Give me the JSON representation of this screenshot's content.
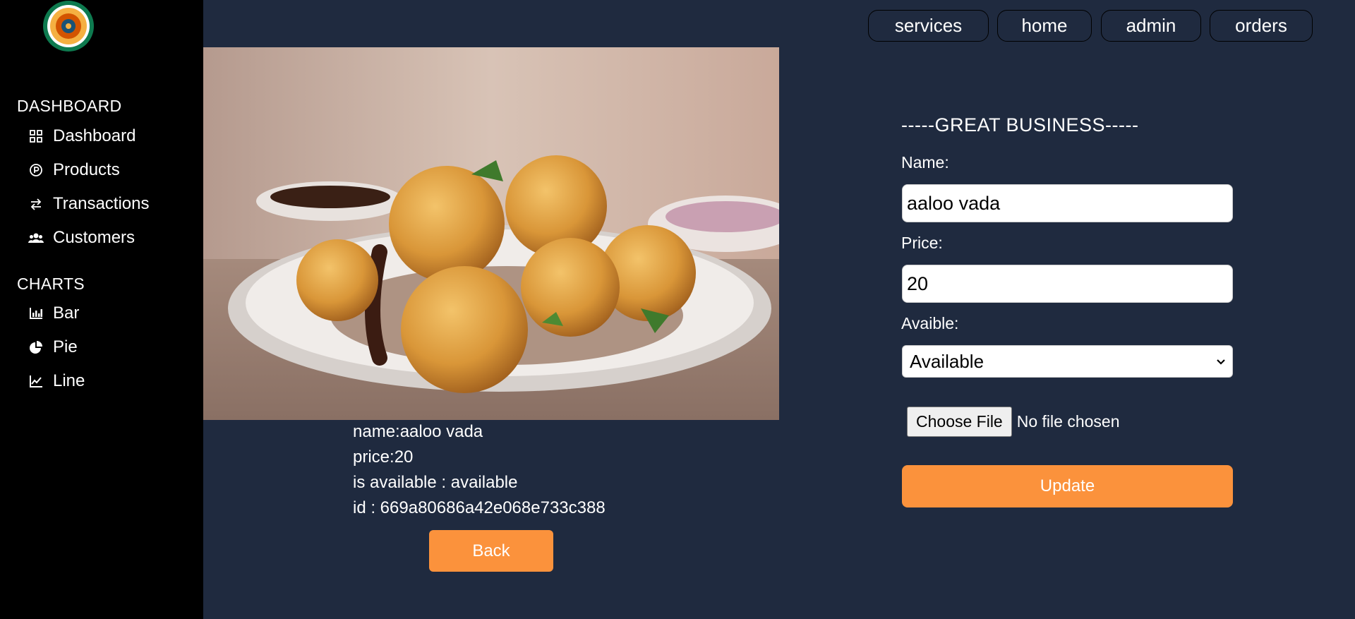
{
  "sidebar": {
    "logo_icon": "college-emblem-icon",
    "sections": [
      {
        "title": "DASHBOARD",
        "items": [
          {
            "label": "Dashboard",
            "icon": "grid-icon"
          },
          {
            "label": "Products",
            "icon": "product-circle-icon"
          },
          {
            "label": "Transactions",
            "icon": "transfer-arrows-icon"
          },
          {
            "label": "Customers",
            "icon": "users-icon"
          }
        ]
      },
      {
        "title": "CHARTS",
        "items": [
          {
            "label": "Bar",
            "icon": "bar-chart-icon"
          },
          {
            "label": "Pie",
            "icon": "pie-chart-icon"
          },
          {
            "label": "Line",
            "icon": "line-chart-icon"
          }
        ]
      }
    ]
  },
  "top_nav": [
    "services",
    "home",
    "admin",
    "orders"
  ],
  "product": {
    "image_icon": "food-photo-image",
    "name_line": "name:aaloo vada",
    "price_line": "price:20",
    "available_line": "is available : available",
    "id_line": "id : 669a80686a42e068e733c388",
    "back_label": "Back"
  },
  "form": {
    "title": "-----GREAT BUSINESS-----",
    "name_label": "Name:",
    "name_value": "aaloo vada",
    "price_label": "Price:",
    "price_value": "20",
    "available_label": "Avaible:",
    "available_selected": "Available",
    "file_button": "Choose File",
    "file_status": "No file chosen",
    "update_label": "Update"
  },
  "colors": {
    "background": "#1f2a3f",
    "sidebar": "#000000",
    "accent": "#fb923c"
  }
}
